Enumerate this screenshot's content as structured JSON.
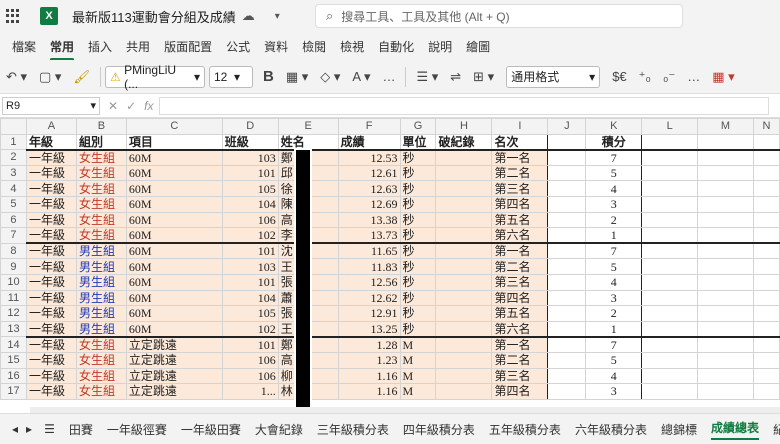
{
  "title_bar": {
    "app_icon": "X",
    "file_name": "最新版113運動會分組及成績",
    "cloud_status_icon": "cloud-sync-icon",
    "search_placeholder": "搜尋工具、工具及其他 (Alt + Q)"
  },
  "menu": [
    "檔案",
    "常用",
    "插入",
    "共用",
    "版面配置",
    "公式",
    "資料",
    "檢閱",
    "檢視",
    "自動化",
    "說明",
    "繪圖"
  ],
  "active_menu": "常用",
  "ribbon": {
    "font_name": "PMingLiU (...",
    "font_size": "12",
    "number_format": "通用格式",
    "currency": "$€"
  },
  "formula_bar": {
    "name_box": "R9",
    "fx": "fx"
  },
  "columns": [
    "A",
    "B",
    "C",
    "D",
    "E",
    "F",
    "G",
    "H",
    "I",
    "J",
    "K",
    "L",
    "M",
    "N"
  ],
  "headers": [
    "年級",
    "組別",
    "項目",
    "班級",
    "姓名",
    "成績",
    "單位",
    "破紀錄",
    "名次",
    "",
    "積分"
  ],
  "rows": [
    {
      "n": "2",
      "a": "一年級",
      "b": "女生組",
      "c": "60M",
      "d": "103",
      "e": "鄭",
      "f": "12.53",
      "g": "秒",
      "i": "第一名",
      "k": "7",
      "g_type": "girl"
    },
    {
      "n": "3",
      "a": "一年級",
      "b": "女生組",
      "c": "60M",
      "d": "101",
      "e": "邱",
      "f": "12.61",
      "g": "秒",
      "i": "第二名",
      "k": "5",
      "g_type": "girl"
    },
    {
      "n": "4",
      "a": "一年級",
      "b": "女生組",
      "c": "60M",
      "d": "105",
      "e": "徐",
      "f": "12.63",
      "g": "秒",
      "i": "第三名",
      "k": "4",
      "g_type": "girl"
    },
    {
      "n": "5",
      "a": "一年級",
      "b": "女生組",
      "c": "60M",
      "d": "104",
      "e": "陳",
      "f": "12.69",
      "g": "秒",
      "i": "第四名",
      "k": "3",
      "g_type": "girl"
    },
    {
      "n": "6",
      "a": "一年級",
      "b": "女生組",
      "c": "60M",
      "d": "106",
      "e": "高",
      "f": "13.38",
      "g": "秒",
      "i": "第五名",
      "k": "2",
      "g_type": "girl"
    },
    {
      "n": "7",
      "a": "一年級",
      "b": "女生組",
      "c": "60M",
      "d": "102",
      "e": "李",
      "f": "13.73",
      "g": "秒",
      "i": "第六名",
      "k": "1",
      "g_type": "girl"
    },
    {
      "n": "8",
      "a": "一年級",
      "b": "男生組",
      "c": "60M",
      "d": "101",
      "e": "沈",
      "f": "11.65",
      "g": "秒",
      "i": "第一名",
      "k": "7",
      "g_type": "boy"
    },
    {
      "n": "9",
      "a": "一年級",
      "b": "男生組",
      "c": "60M",
      "d": "103",
      "e": "王",
      "f": "11.83",
      "g": "秒",
      "i": "第二名",
      "k": "5",
      "g_type": "boy"
    },
    {
      "n": "10",
      "a": "一年級",
      "b": "男生組",
      "c": "60M",
      "d": "101",
      "e": "張",
      "f": "12.56",
      "g": "秒",
      "i": "第三名",
      "k": "4",
      "g_type": "boy"
    },
    {
      "n": "11",
      "a": "一年級",
      "b": "男生組",
      "c": "60M",
      "d": "104",
      "e": "蕭",
      "f": "12.62",
      "g": "秒",
      "i": "第四名",
      "k": "3",
      "g_type": "boy"
    },
    {
      "n": "12",
      "a": "一年級",
      "b": "男生組",
      "c": "60M",
      "d": "105",
      "e": "張",
      "f": "12.91",
      "g": "秒",
      "i": "第五名",
      "k": "2",
      "g_type": "boy"
    },
    {
      "n": "13",
      "a": "一年級",
      "b": "男生組",
      "c": "60M",
      "d": "102",
      "e": "王",
      "f": "13.25",
      "g": "秒",
      "i": "第六名",
      "k": "1",
      "g_type": "boy"
    },
    {
      "n": "14",
      "a": "一年級",
      "b": "女生組",
      "c": "立定跳遠",
      "d": "101",
      "e": "鄭",
      "f": "1.28",
      "g": "M",
      "i": "第一名",
      "k": "7",
      "g_type": "girl"
    },
    {
      "n": "15",
      "a": "一年級",
      "b": "女生組",
      "c": "立定跳遠",
      "d": "106",
      "e": "高",
      "f": "1.23",
      "g": "M",
      "i": "第二名",
      "k": "5",
      "g_type": "girl"
    },
    {
      "n": "16",
      "a": "一年級",
      "b": "女生組",
      "c": "立定跳遠",
      "d": "106",
      "e": "柳",
      "f": "1.16",
      "g": "M",
      "i": "第三名",
      "k": "4",
      "g_type": "girl"
    },
    {
      "n": "17",
      "a": "一年級",
      "b": "女生組",
      "c": "立定跳遠",
      "d": "1...",
      "e": "林",
      "f": "1.16",
      "g": "M",
      "i": "第四名",
      "k": "3",
      "g_type": "girl"
    }
  ],
  "sheet_tabs": [
    "田賽",
    "一年級徑賽",
    "一年級田賽",
    "大會紀錄",
    "三年級積分表",
    "四年級積分表",
    "五年級積分表",
    "六年級積分表",
    "總錦標",
    "成績總表",
    "紀錄表"
  ],
  "active_sheet": "成績總表"
}
